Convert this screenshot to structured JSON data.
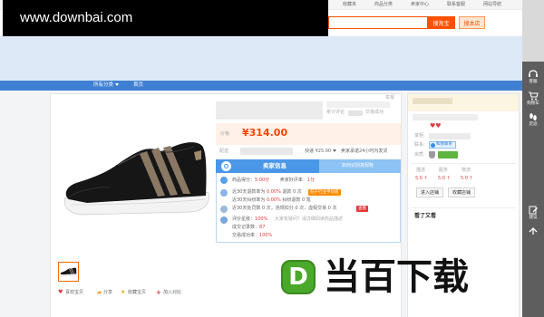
{
  "watermark": {
    "site_url": "www.downbai.com",
    "logo_letter": "D",
    "logo_text": "当百下载"
  },
  "top_nav": {
    "items": [
      "收藏夹",
      "商品分类",
      "卖家中心",
      "联系客服",
      "网站导航"
    ]
  },
  "search": {
    "query": "",
    "search_taobao_button": "搜淘宝",
    "search_shop_button": "搜本店"
  },
  "shop_nav": {
    "all_categories": "所有分类",
    "home": "首页"
  },
  "product": {
    "report_link": "举报",
    "total_reviews_label": "累计评论",
    "deals_label": "交易成功",
    "price_label": "价格",
    "price": "¥314.00",
    "shipping_label": "配送",
    "shipping_fee": "快递 ¥25.00",
    "shipping_promise": "卖家承诺24小时内发货"
  },
  "seller_panel": {
    "tab_seller_info": "卖家信息",
    "tab_authenticity": "如何识别真假鞋",
    "score_label": "商品得分：",
    "score_value": "5.00分",
    "praise_label": "卖家好评率：",
    "praise_value": "1分",
    "refund_text": "近30天退款率为 ",
    "refund_rate": "0.00%",
    "refund_count_text": " 退款 0 次",
    "refund_badge": "低于行业平均值",
    "dispute_text": "近30天纠纷率为 ",
    "dispute_rate": "0.00%",
    "dispute_count_text": " 纠纷退款 0 笔",
    "penalty_text": "近30天处罚数 0 次，违规扣分 0 次，虚假交易 0 次",
    "penalty_badge": "查看",
    "rating_label": "评价星级：",
    "rating_value": "100%",
    "rating_note": "大家有疑问？请详细阅读商品描述",
    "deals_count_label": "成交记录数：",
    "deals_count_value": "87",
    "success_label": "交易成功率：",
    "success_value": "100%"
  },
  "shop": {
    "credit_hearts": "♥♥",
    "keeper_label": "掌柜:",
    "contact_label": "联系:",
    "contact_button": "和我联系",
    "qualification_label": "资质:",
    "ratings": [
      {
        "label": "描述",
        "value": "5.0",
        "trend": "↑"
      },
      {
        "label": "服务",
        "value": "5.0",
        "trend": "↑"
      },
      {
        "label": "物流",
        "value": "5.0",
        "trend": "↑"
      }
    ],
    "enter_shop_button": "进入店铺",
    "favorite_shop_button": "收藏店铺",
    "also_viewed_title": "看了又看"
  },
  "actions": {
    "like": "喜欢宝贝",
    "share": "分享",
    "favorite": "收藏宝贝",
    "compare": "加入对比"
  },
  "sidebar": {
    "items": [
      {
        "label": "客服",
        "icon": "headset-icon"
      },
      {
        "label": "购物车",
        "icon": "cart-icon"
      },
      {
        "label": "足迹",
        "icon": "footprint-icon"
      },
      {
        "label": "建议",
        "icon": "feedback-icon"
      }
    ],
    "back_to_top_icon": "arrow-up-icon"
  },
  "colors": {
    "nav_blue": "#3f80d3",
    "accent_orange": "#ff5000",
    "price_red": "#ff4400",
    "panel_blue": "#4a97e8",
    "logo_green": "#4aa82a",
    "shoe_stripe": "#8a7865"
  }
}
